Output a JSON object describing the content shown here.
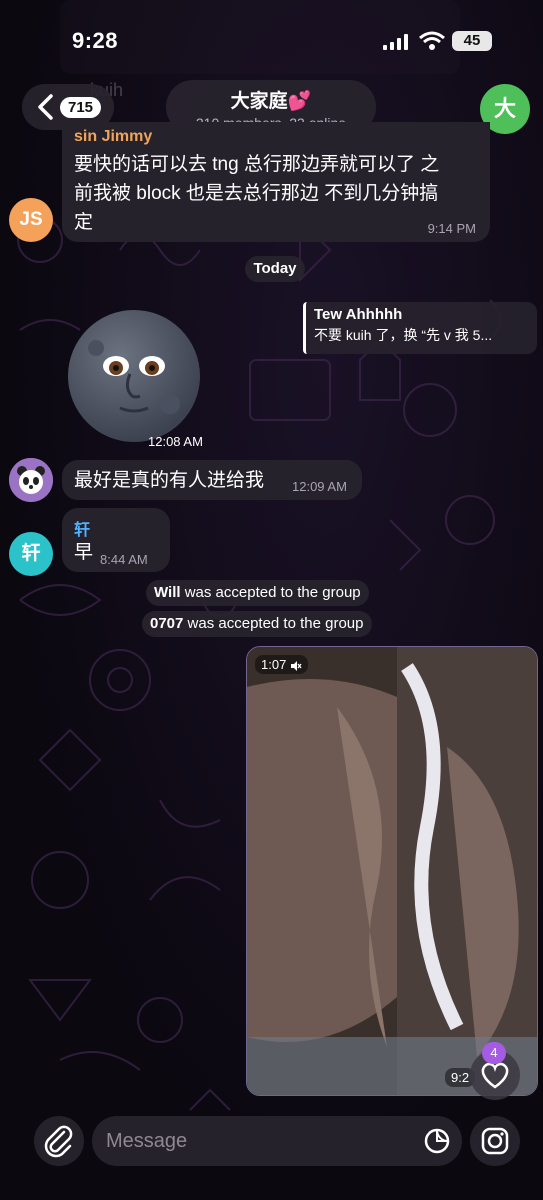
{
  "status_bar": {
    "time": "9:28",
    "battery": "45"
  },
  "ghost": {
    "text": "kuih"
  },
  "header": {
    "back_count": "715",
    "group_name": "大家庭💕",
    "group_subtitle": "210 members, 23 online",
    "avatar_letter": "大"
  },
  "messages": [
    {
      "sender": "sin Jimmy",
      "text_line1": "要快的话可以去 tng 总行那边弄就可以了 之",
      "text_line2": "前我被 block 也是去总行那边 不到几分钟搞",
      "text_line3": "定",
      "time": "9:14 PM",
      "avatar": "JS"
    },
    {
      "sticker_time": "12:08 AM"
    },
    {
      "text": "最好是真的有人进给我",
      "time": "12:09 AM"
    },
    {
      "sender": "轩",
      "text": "早",
      "time": "8:44 AM",
      "avatar": "轩"
    }
  ],
  "date_chip": "Today",
  "reply": {
    "name": "Tew Ahhhhh",
    "text": "不要 kuih 了，换 “先 v 我 5..."
  },
  "service_messages": [
    {
      "name": "Will",
      "text": " was accepted to the group"
    },
    {
      "name": "0707",
      "text": " was accepted to the group"
    }
  ],
  "video": {
    "duration": "1:07",
    "time": "9:2"
  },
  "reaction": {
    "count": "4"
  },
  "composer": {
    "placeholder": "Message"
  },
  "colors": {
    "accent": "#a55be2",
    "avatar_green": "#4fbf5a",
    "avatar_orange": "#f4a15a",
    "avatar_cyan": "#2bc3c9",
    "sender_blue": "#4fb3ff",
    "sender_orange": "#f0a35a"
  }
}
